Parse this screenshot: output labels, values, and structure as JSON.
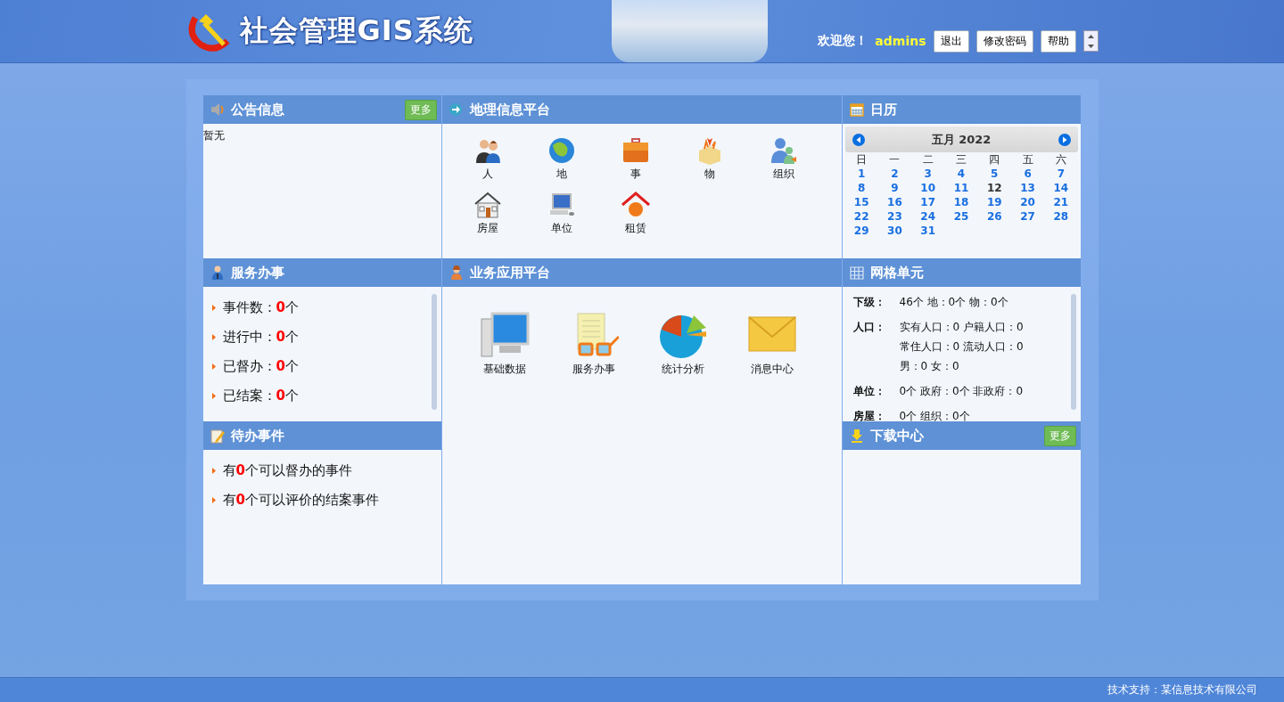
{
  "header": {
    "title": "社会管理GIS系统",
    "welcome": "欢迎您！",
    "username": "admins",
    "buttons": [
      "退出",
      "修改密码",
      "帮助"
    ]
  },
  "announcements": {
    "title": "公告信息",
    "more": "更多",
    "items": [
      "暂无"
    ]
  },
  "geo_platform": {
    "title": "地理信息平台",
    "items": [
      "人",
      "地",
      "事",
      "物",
      "组织",
      "房屋",
      "单位",
      "租赁"
    ]
  },
  "calendar": {
    "title": "日历",
    "month": "五月 2022",
    "weekdays": [
      "日",
      "一",
      "二",
      "三",
      "四",
      "五",
      "六"
    ],
    "days": [
      {
        "day": "1",
        "today": false
      },
      {
        "day": "2",
        "today": false
      },
      {
        "day": "3",
        "today": false
      },
      {
        "day": "4",
        "today": false
      },
      {
        "day": "5",
        "today": false
      },
      {
        "day": "6",
        "today": false
      },
      {
        "day": "7",
        "today": false
      },
      {
        "day": "8",
        "today": false
      },
      {
        "day": "9",
        "today": false
      },
      {
        "day": "10",
        "today": false
      },
      {
        "day": "11",
        "today": false
      },
      {
        "day": "12",
        "today": true
      },
      {
        "day": "13",
        "today": false
      },
      {
        "day": "14",
        "today": false
      },
      {
        "day": "15",
        "today": false
      },
      {
        "day": "16",
        "today": false
      },
      {
        "day": "17",
        "today": false
      },
      {
        "day": "18",
        "today": false
      },
      {
        "day": "19",
        "today": false
      },
      {
        "day": "20",
        "today": false
      },
      {
        "day": "21",
        "today": false
      },
      {
        "day": "22",
        "today": false
      },
      {
        "day": "23",
        "today": false
      },
      {
        "day": "24",
        "today": false
      },
      {
        "day": "25",
        "today": false
      },
      {
        "day": "26",
        "today": false
      },
      {
        "day": "27",
        "today": false
      },
      {
        "day": "28",
        "today": false
      },
      {
        "day": "29",
        "today": false
      },
      {
        "day": "30",
        "today": false
      },
      {
        "day": "31",
        "today": false
      }
    ]
  },
  "service": {
    "title": "服务办事",
    "stats": [
      {
        "label": "事件数：",
        "count": "0",
        "unit": "个"
      },
      {
        "label": "进行中：",
        "count": "0",
        "unit": "个"
      },
      {
        "label": "已督办：",
        "count": "0",
        "unit": "个"
      },
      {
        "label": "已结案：",
        "count": "0",
        "unit": "个"
      }
    ]
  },
  "business_platform": {
    "title": "业务应用平台",
    "items": [
      "基础数据",
      "服务办事",
      "统计分析",
      "消息中心"
    ]
  },
  "grid_unit": {
    "title": "网格单元",
    "rows": [
      {
        "label": "下级：",
        "lines": [
          "46个 地：0个 物：0个"
        ]
      },
      {
        "label": "人口：",
        "lines": [
          "实有人口：0 户籍人口：0",
          "常住人口：0 流动人口：0",
          "男：0 女：0"
        ]
      },
      {
        "label": "单位：",
        "lines": [
          "0个 政府：0个 非政府：0"
        ]
      },
      {
        "label": "房屋：",
        "lines": [
          "0个 组织：0个"
        ]
      }
    ]
  },
  "todo": {
    "title": "待办事件",
    "items": [
      {
        "prefix": "有",
        "count": "0",
        "suffix": "个可以督办的事件"
      },
      {
        "prefix": "有",
        "count": "0",
        "suffix": "个可以评价的结案事件"
      }
    ]
  },
  "downloads": {
    "title": "下载中心",
    "more": "更多"
  },
  "footer": "技术支持：某信息技术有限公司"
}
